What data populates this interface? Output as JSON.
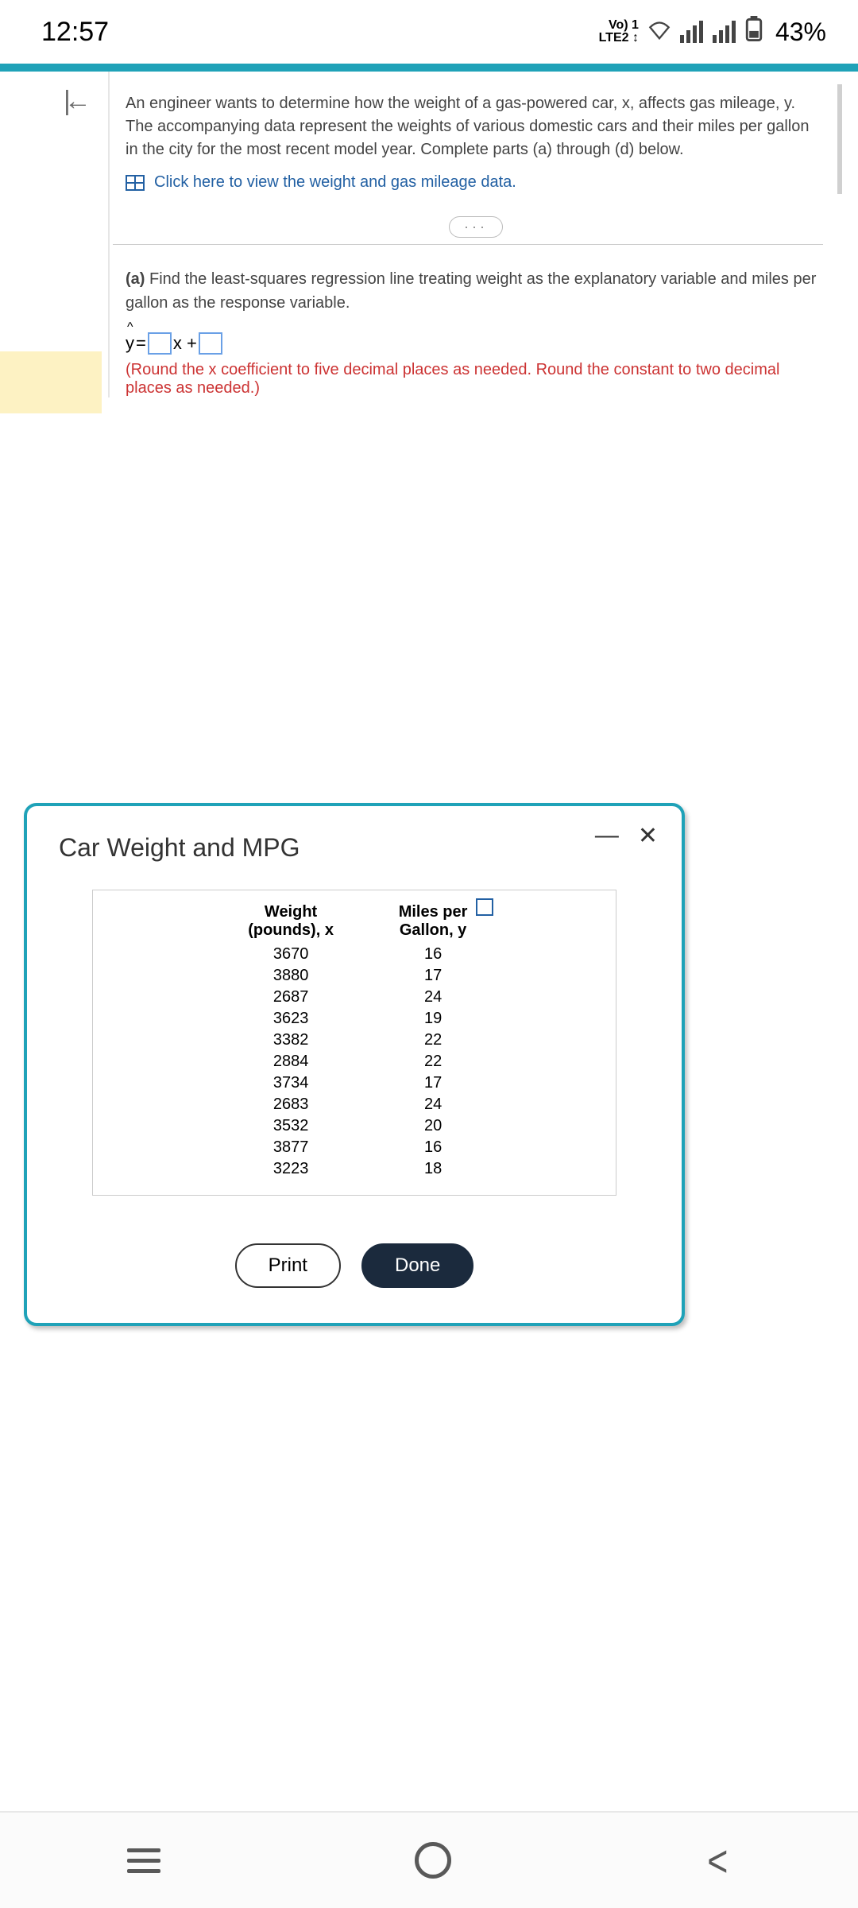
{
  "status": {
    "time": "12:57",
    "vo_line1": "Vo) 1",
    "vo_line2": "LTE2 ↕",
    "battery": "43%"
  },
  "problem": {
    "text": "An engineer wants to determine how the weight of a gas-powered car, x, affects gas mileage, y. The accompanying data represent the weights of various domestic cars and their miles per gallon in the city for the most recent model year. Complete parts (a) through (d) below.",
    "view_link": "Click here to view the weight and gas mileage data."
  },
  "part_a": {
    "label": "(a)",
    "text": "Find the least-squares regression line treating weight as the explanatory variable and miles per gallon as the response variable.",
    "eq_y": "y",
    "eq_equals": " = ",
    "eq_x": "x + ",
    "round_note": "(Round the x coefficient to five decimal places as needed. Round the constant to two decimal places as needed.)"
  },
  "modal": {
    "title": "Car Weight and MPG",
    "minimize": "—",
    "close": "✕",
    "col1": "Weight (pounds), x",
    "col2": "Miles per Gallon, y",
    "print": "Print",
    "done": "Done"
  },
  "chart_data": {
    "type": "table",
    "columns": [
      "Weight (pounds), x",
      "Miles per Gallon, y"
    ],
    "rows": [
      [
        3670,
        16
      ],
      [
        3880,
        17
      ],
      [
        2687,
        24
      ],
      [
        3623,
        19
      ],
      [
        3382,
        22
      ],
      [
        2884,
        22
      ],
      [
        3734,
        17
      ],
      [
        2683,
        24
      ],
      [
        3532,
        20
      ],
      [
        3877,
        16
      ],
      [
        3223,
        18
      ]
    ]
  }
}
